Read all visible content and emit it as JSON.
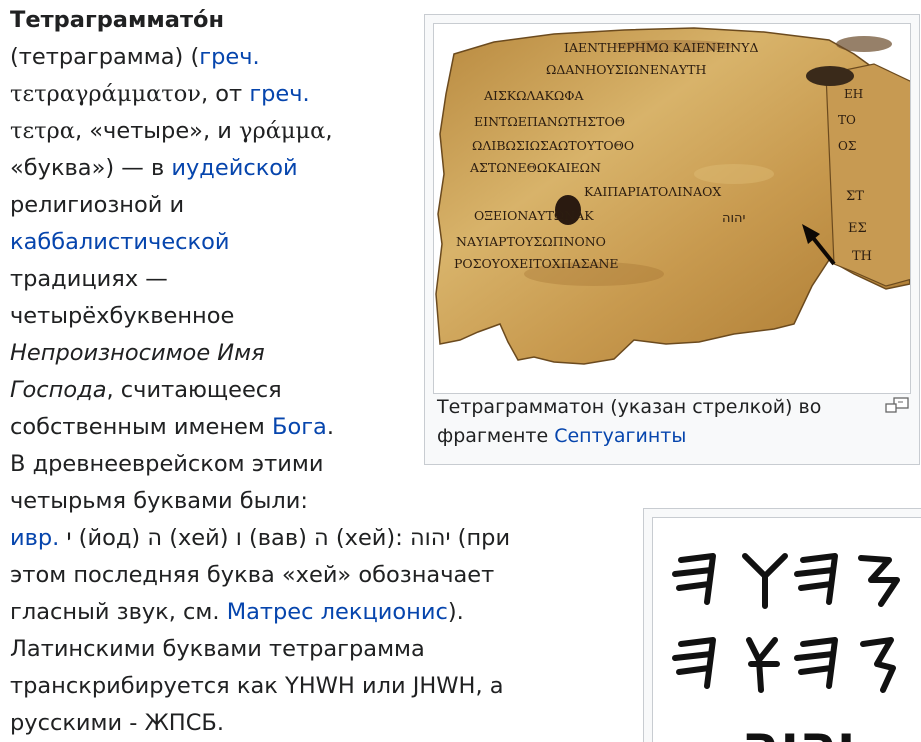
{
  "article": {
    "title": "Тетраграммато́н",
    "l2_a": "(тетраграмма) (",
    "l2_link": "греч.",
    "l3_greek": "τετραγράμματον",
    "l3_mid": ", от ",
    "l3_link": "греч.",
    "l4_greek1": "τετρα",
    "l4_mid": ", «четыре», и ",
    "l4_greek2": "γράμμα",
    "l4_end": ",",
    "l5_a": "«буква») — в ",
    "l5_link": "иудейской",
    "l6": "религиозной и",
    "l7_link": "каббалистической",
    "l8": "традициях —",
    "l9": "четырёхбуквенное",
    "l10_ital": "Непроизносимое Имя",
    "l11_ital": "Господа",
    "l11_rest": ", считающееся",
    "l12_a": "собственным именем ",
    "l12_link": "Бога",
    "l12_end": ".",
    "l13": "В древнееврейском этими",
    "l14": "четырьмя буквами были:",
    "l15_link": "ивр.",
    "l15_rest": " י (йод) ה (хей) ו (вав) ה (хей): יהוה (при",
    "l16": "этом последняя буква «хей» обозначает",
    "l17_a": "гласный звук, см. ",
    "l17_link": "Матрес лекционис",
    "l17_end": ").",
    "l18": "Латинскими буквами тетраграмма",
    "l19": "транскрибируется как YHWH или JHWH, а",
    "l20": "русскими - ЖПСБ."
  },
  "figure1": {
    "caption_line1": "Тетраграмматон (указан стрелкой) во",
    "caption_line2_a": "фрагменте ",
    "caption_link": "Септуагинты",
    "image_icon": "magnify-clip-icon",
    "scroll_text_lines": [
      "ΙΑΕΝΤΗΕΡΗΜΩ ΚΑΙΕΝΕΙΝΥΔ",
      "ΩΔΑΝΗΟΥΣΙΩΝΕΝΑΥΤΗ",
      "ΑΙΣΚΩΛΑΚΩΦΑ",
      "ΕΙΝΤΩΕΠΑΝΩΤΗΣΤΟΘ",
      "ΩΛΙΒΩΣΙΩΣΑΩΤΟΥΤΟΘΟ",
      "ΑΣΤΩΝΕΘΩΚΑΙΕΩΝ",
      "ΚΑΙΠΑΡΙΑΤΟΛΙΝΑΟΧ",
      "ΟΞΕΙΟΝΑΥΤΩΝΑΚ",
      "ΝΑΥΙΑΡΤΟΥΣΩΠΝΟΝΟ",
      "ΡΟΣΟΥΟΧΕΙΤΟΧΠΑΣΑΝΕ"
    ],
    "tetragram": "יהוה"
  },
  "figure2": {
    "row1": "𐤉𐤄𐤅𐤄",
    "row2": "𐤉𐤄𐤅𐤄",
    "row3": "יהוה"
  }
}
